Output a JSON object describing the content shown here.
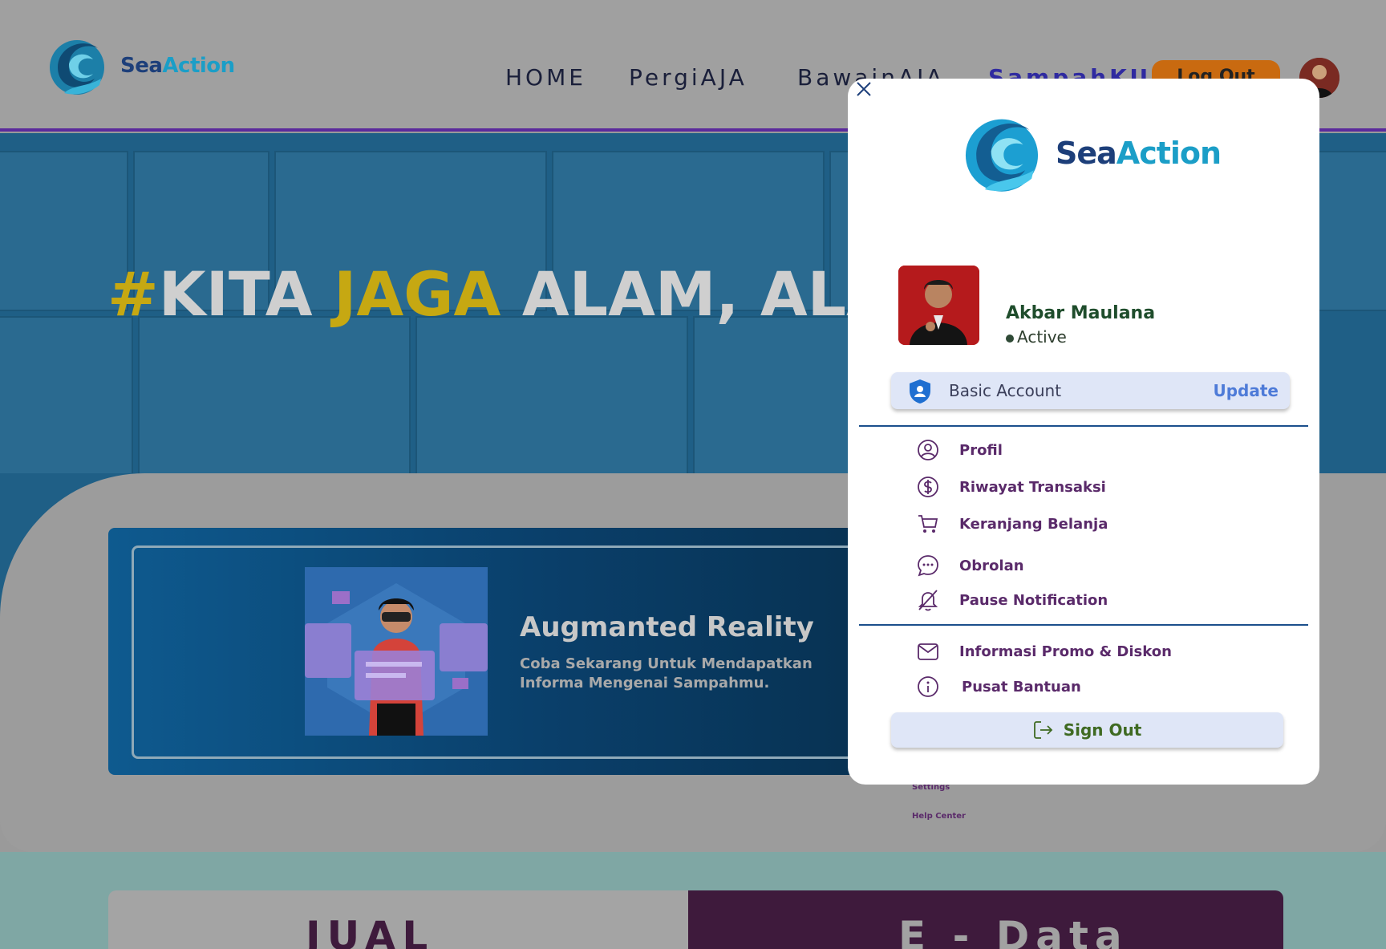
{
  "header": {
    "logo": {
      "sea": "Sea",
      "action": "Action"
    },
    "nav": [
      "HOME",
      "PergiAJA",
      "BawainAJA",
      "SampahKU"
    ],
    "logout_label": "Log Out"
  },
  "hero": {
    "hash": "#",
    "kita": "KITA ",
    "jaga": "JAGA",
    "rest": " ALAM, ALA"
  },
  "ar_card": {
    "title": "Augmanted Reality",
    "subtitle": "Coba Sekarang Untuk Mendapatkan Informa Mengenai Sampahmu."
  },
  "ghost_links": [
    "Settings",
    "Help Center"
  ],
  "bottom": {
    "jual": "JUAL",
    "edata": "E - Data"
  },
  "popup": {
    "logo": {
      "sea": "Sea",
      "action": "Action"
    },
    "user": {
      "name": "Akbar Maulana",
      "status": "Active"
    },
    "account": {
      "label": "Basic Account",
      "update": "Update"
    },
    "menu_primary": [
      {
        "label": "Profil",
        "icon": "user-circle-icon"
      },
      {
        "label": "Riwayat Transaksi",
        "icon": "dollar-circle-icon"
      },
      {
        "label": "Keranjang Belanja",
        "icon": "cart-icon"
      },
      {
        "label": "Obrolan",
        "icon": "chat-icon"
      },
      {
        "label": "Pause Notification",
        "icon": "bell-off-icon"
      }
    ],
    "menu_secondary": [
      {
        "label": "Informasi Promo & Diskon",
        "icon": "mail-icon"
      },
      {
        "label": "Pusat Bantuan",
        "icon": "info-icon"
      }
    ],
    "signout": "Sign Out"
  },
  "colors": {
    "accent_purple": "#5a2a6a",
    "brand_navy": "#1d3f7a",
    "brand_teal": "#1b9ec7",
    "update_blue": "#4e7bd8",
    "signout_green": "#3f6a22",
    "hero_yellow": "#c6a812"
  }
}
